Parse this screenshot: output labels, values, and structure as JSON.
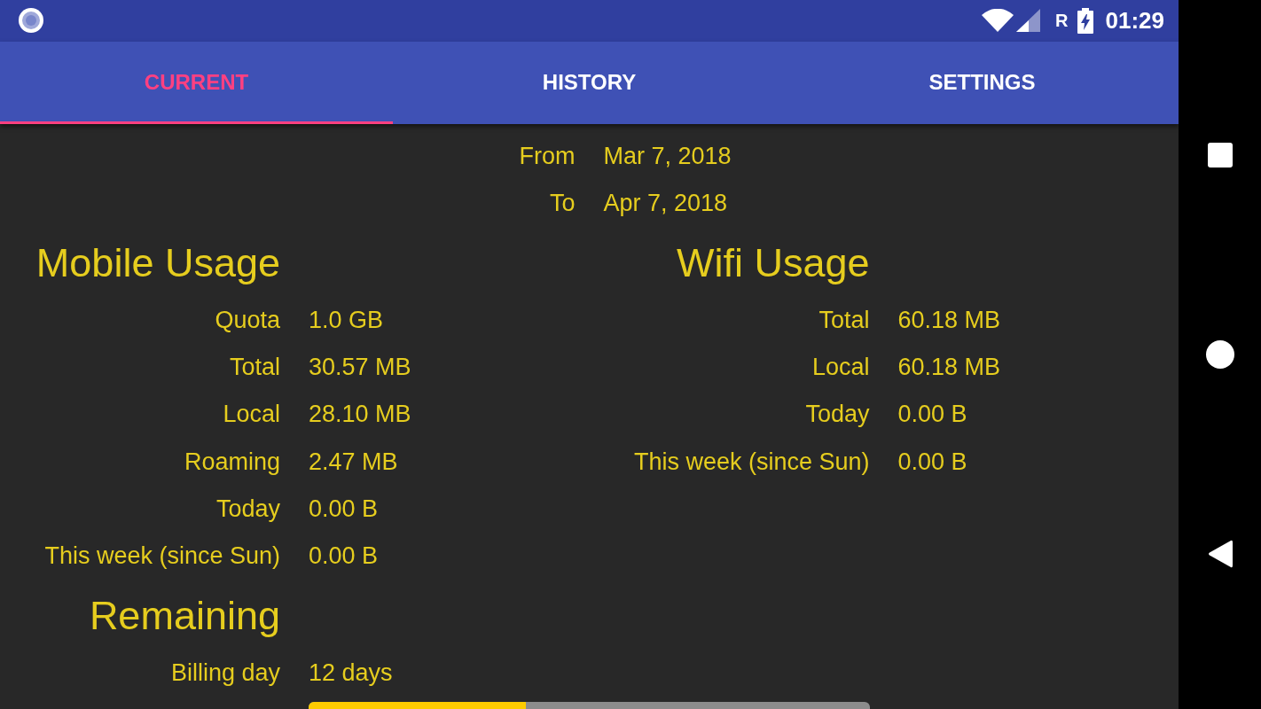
{
  "status_bar": {
    "roaming_indicator": "R",
    "time": "01:29"
  },
  "tabs": [
    {
      "label": "CURRENT",
      "selected": true
    },
    {
      "label": "HISTORY",
      "selected": false
    },
    {
      "label": "SETTINGS",
      "selected": false
    }
  ],
  "period": [
    {
      "label": "From",
      "value": "Mar 7, 2018"
    },
    {
      "label": "To",
      "value": "Apr 7, 2018"
    }
  ],
  "mobile_usage": {
    "title": "Mobile Usage",
    "rows": [
      {
        "label": "Quota",
        "value": "1.0 GB"
      },
      {
        "label": "Total",
        "value": "30.57 MB"
      },
      {
        "label": "Local",
        "value": "28.10 MB"
      },
      {
        "label": "Roaming",
        "value": "2.47 MB"
      },
      {
        "label": "Today",
        "value": "0.00 B"
      },
      {
        "label": "This week (since Sun)",
        "value": "0.00 B"
      }
    ]
  },
  "wifi_usage": {
    "title": "Wifi Usage",
    "rows": [
      {
        "label": "Total",
        "value": "60.18 MB"
      },
      {
        "label": "Local",
        "value": "60.18 MB"
      },
      {
        "label": "Today",
        "value": "0.00 B"
      },
      {
        "label": "This week (since Sun)",
        "value": "0.00 B"
      }
    ]
  },
  "remaining": {
    "title": "Remaining",
    "rows": [
      {
        "label": "Billing day",
        "value": "12 days"
      }
    ],
    "progress_bar": {
      "level": 0.387
    }
  }
}
